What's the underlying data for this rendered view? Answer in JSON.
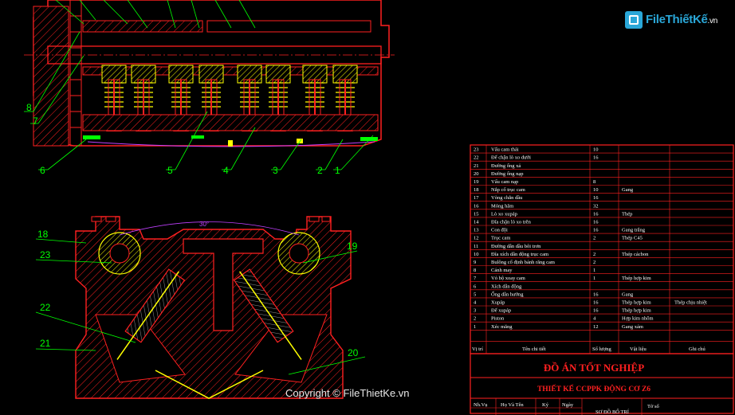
{
  "watermark": {
    "brand": "FileThiếtKế",
    "tld": ".vn",
    "copyright": "Copyright © FileThietKe.vn"
  },
  "callouts": {
    "top": [
      "8",
      "7",
      "6",
      "5",
      "4",
      "3",
      "2",
      "1"
    ],
    "bottom": [
      "18",
      "23",
      "22",
      "21",
      "19",
      "20"
    ],
    "angle": "30°"
  },
  "parts_table": {
    "header": {
      "no": "Vị trí",
      "name": "Tên chi tiết",
      "qty": "Số lượng",
      "material": "Vật liệu",
      "note": "Ghi chú"
    },
    "rows": [
      {
        "no": "23",
        "name": "Vấu cam thải",
        "qty": "10",
        "material": "",
        "note": ""
      },
      {
        "no": "22",
        "name": "Đế chặn lò xo dưới",
        "qty": "16",
        "material": "",
        "note": ""
      },
      {
        "no": "21",
        "name": "Đường ống xả",
        "qty": "",
        "material": "",
        "note": ""
      },
      {
        "no": "20",
        "name": "Đường ống nạp",
        "qty": "",
        "material": "",
        "note": ""
      },
      {
        "no": "19",
        "name": "Vấu cam nạp",
        "qty": "8",
        "material": "",
        "note": ""
      },
      {
        "no": "18",
        "name": "Nắp cổ trục cam",
        "qty": "10",
        "material": "Gang",
        "note": ""
      },
      {
        "no": "17",
        "name": "Vòng chắn dầu",
        "qty": "16",
        "material": "",
        "note": ""
      },
      {
        "no": "16",
        "name": "Móng hãm",
        "qty": "32",
        "material": "",
        "note": ""
      },
      {
        "no": "15",
        "name": "Lò xo xupáp",
        "qty": "16",
        "material": "Thép",
        "note": ""
      },
      {
        "no": "14",
        "name": "Đĩa chặn lò xo trên",
        "qty": "16",
        "material": "",
        "note": ""
      },
      {
        "no": "13",
        "name": "Con đội",
        "qty": "16",
        "material": "Gang trắng",
        "note": ""
      },
      {
        "no": "12",
        "name": "Trục cam",
        "qty": "2",
        "material": "Thép C45",
        "note": ""
      },
      {
        "no": "11",
        "name": "Đường dẫn dầu bôi trơn",
        "qty": "",
        "material": "",
        "note": ""
      },
      {
        "no": "10",
        "name": "Đĩa xích dẫn động trục cam",
        "qty": "2",
        "material": "Thép cácbon",
        "note": ""
      },
      {
        "no": "9",
        "name": "Bulông cố định bánh răng cam",
        "qty": "2",
        "material": "",
        "note": ""
      },
      {
        "no": "8",
        "name": "Cánh may",
        "qty": "1",
        "material": "",
        "note": ""
      },
      {
        "no": "7",
        "name": "Vỏ bộ xoay cam",
        "qty": "1",
        "material": "Thép hợp kim",
        "note": ""
      },
      {
        "no": "6",
        "name": "Xích dẫn động",
        "qty": "",
        "material": "",
        "note": ""
      },
      {
        "no": "5",
        "name": "Ống dẫn hướng",
        "qty": "16",
        "material": "Gang",
        "note": ""
      },
      {
        "no": "4",
        "name": "Xupáp",
        "qty": "16",
        "material": "Thép hợp kim",
        "note": "Thép chịu nhiệt"
      },
      {
        "no": "3",
        "name": "Đế xupáp",
        "qty": "16",
        "material": "Thép hợp kim",
        "note": ""
      },
      {
        "no": "2",
        "name": "Piston",
        "qty": "4",
        "material": "Hợp kim nhôm",
        "note": ""
      },
      {
        "no": "1",
        "name": "Xéc măng",
        "qty": "12",
        "material": "Gang xám",
        "note": ""
      }
    ]
  },
  "title_block": {
    "project": "ĐỒ ÁN TỐT NGHIỆP",
    "subject": "THIẾT KẾ CCPPK ĐỘNG CƠ Z6",
    "sign_row": [
      "Nh.Vụ",
      "Họ Và Tên",
      "Ký",
      "Ngày"
    ],
    "drawing_name": "SƠ ĐỒ BỐ TRÍ",
    "sheet": "Tờ số"
  },
  "colors": {
    "background": "#000000",
    "outline": "#ff2020",
    "hatch": "#ff2020",
    "spring": "#ffff00",
    "leader": "#00ff00",
    "table_line": "#ff2020",
    "table_text": "#ffffff",
    "watermark": "#2aa7d8"
  }
}
